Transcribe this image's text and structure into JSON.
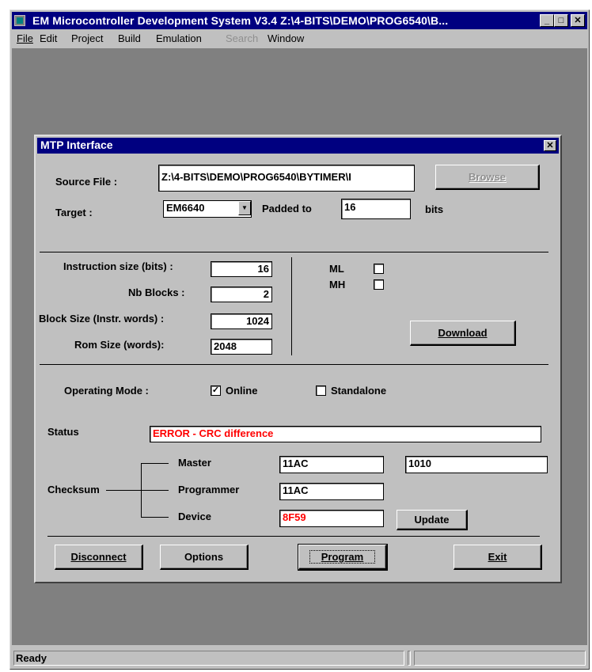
{
  "window": {
    "title": "EM Microcontroller Development System V3.4 Z:\\4-BITS\\DEMO\\PROG6540\\B...",
    "minimize": "_",
    "maximize": "□",
    "close": "✕"
  },
  "menu": {
    "file": "File",
    "edit": "Edit",
    "project": "Project",
    "build": "Build",
    "emulation": "Emulation",
    "search": "Search",
    "window": "Window"
  },
  "status": {
    "ready": "Ready",
    "pane2": "",
    "pane3": ""
  },
  "dialog": {
    "title": "MTP Interface",
    "close": "✕",
    "source_file_label": "Source File :",
    "source_file_value": "Z:\\4-BITS\\DEMO\\PROG6540\\BYTIMER\\I",
    "browse_label": "Browse",
    "target_label": "Target :",
    "target_value": "EM6640",
    "padded_label": "Padded to",
    "padded_value": "16",
    "bits_label": "bits",
    "instruction_size_label": "Instruction size (bits) :",
    "instruction_size_value": "16",
    "nb_blocks_label": "Nb Blocks :",
    "nb_blocks_value": "2",
    "block_size_label": "Block Size (Instr. words) :",
    "block_size_value": "1024",
    "rom_size_label": "Rom Size  (words):",
    "rom_size_value": "2048",
    "ml_label": "ML",
    "mh_label": "MH",
    "download_label": "Download",
    "operating_mode_label": "Operating Mode :",
    "online_label": "Online",
    "online_checked": "✓",
    "standalone_label": "Standalone",
    "status_label": "Status",
    "status_value": "ERROR - CRC difference",
    "checksum_label": "Checksum",
    "master_label": "Master",
    "master_value": "11AC",
    "master_value2": "1010",
    "programmer_label": "Programmer",
    "programmer_value": "11AC",
    "device_label": "Device",
    "device_value": "8F59",
    "update_label": "Update",
    "disconnect_label": "Disconnect",
    "options_label": "Options",
    "program_label": "Program",
    "exit_label": "Exit"
  },
  "colors": {
    "titlebar": "#000080",
    "face": "#c0c0c0",
    "workspace": "#808080",
    "error_text": "#ff0000"
  }
}
